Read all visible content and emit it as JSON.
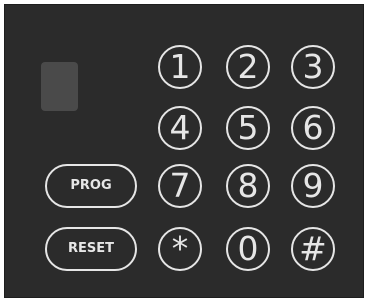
{
  "keypad": {
    "keys": [
      "1",
      "2",
      "3",
      "4",
      "5",
      "6",
      "7",
      "8",
      "9",
      "*",
      "0",
      "#"
    ],
    "prog_label": "PROG",
    "reset_label": "RESET"
  },
  "colors": {
    "panel": "#2b2b2b",
    "key_outline": "#e6e6e6",
    "indicator": "#4a4a4a"
  }
}
